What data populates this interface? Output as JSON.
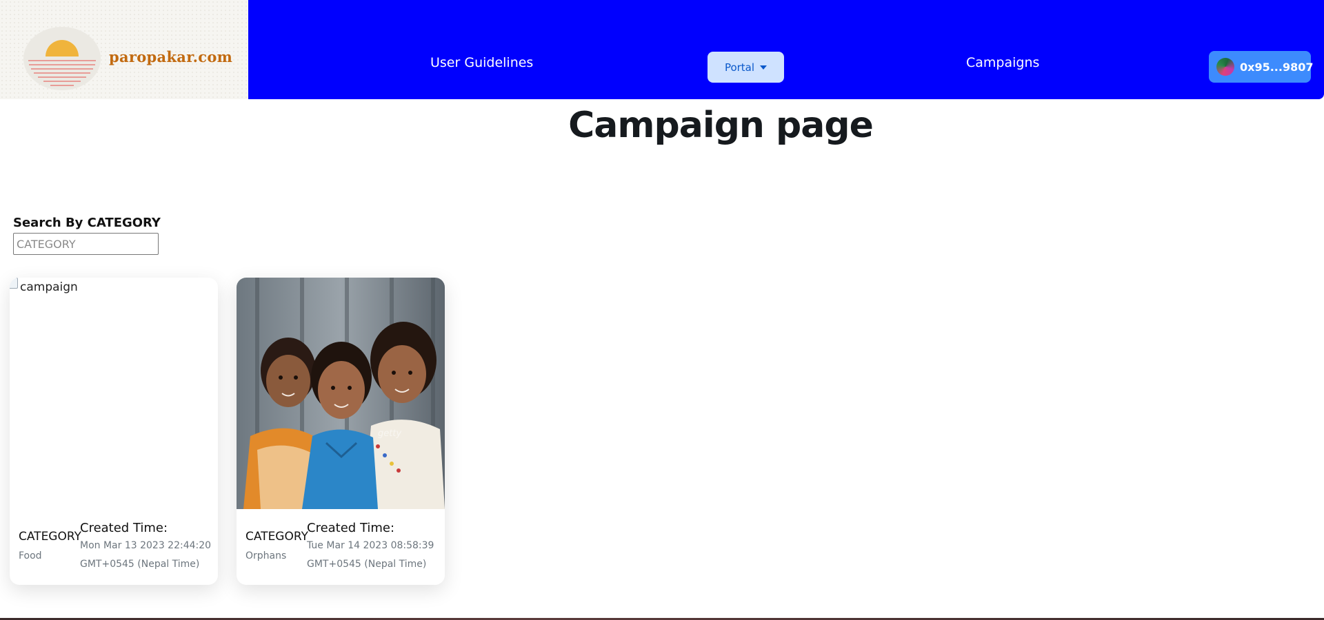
{
  "brand": {
    "logo_text": "paropakar.com",
    "colors": {
      "navbar": "#0000fe",
      "logo_text": "#c26a10",
      "sun": "#f0b43c",
      "lines": "#e8837e"
    }
  },
  "nav": {
    "guidelines_label": "User Guidelines",
    "portal_label": "Portal",
    "campaigns_label": "Campaigns",
    "wallet_label": "0x95...9807"
  },
  "page": {
    "title": "Campaign page"
  },
  "search": {
    "label": "Search By CATEGORY",
    "placeholder": "CATEGORY",
    "value": ""
  },
  "cards": [
    {
      "image_alt": "campaign",
      "category_label": "CATEGORY",
      "category_value": "Food",
      "created_label": "Created Time:",
      "created_value": "Mon Mar 13 2023 22:44:20 GMT+0545 (Nepal Time)"
    },
    {
      "image_alt": "campaign",
      "category_label": "CATEGORY",
      "category_value": "Orphans",
      "created_label": "Created Time:",
      "created_value": "Tue Mar 14 2023 08:58:39 GMT+0545 (Nepal Time)"
    }
  ],
  "icons": {
    "dropdown": "caret-down-icon",
    "wallet": "wallet-avatar-icon",
    "broken_image": "broken-image-icon"
  }
}
